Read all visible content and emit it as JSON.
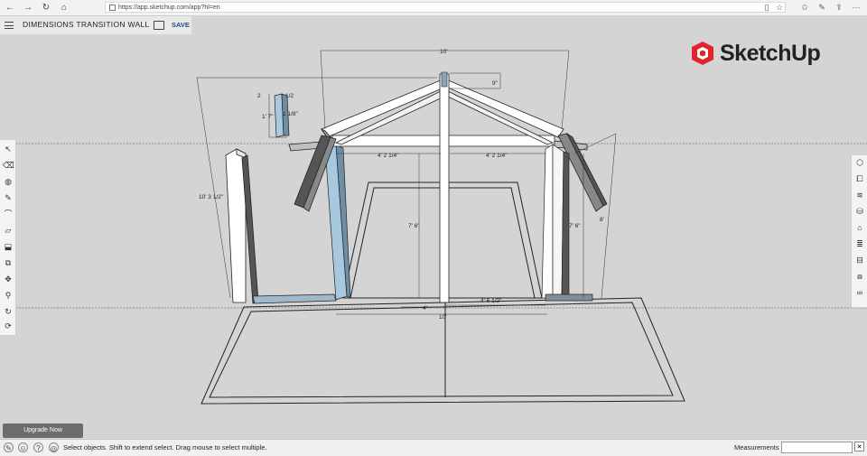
{
  "browser": {
    "url": "https://app.sketchup.com/app?hl=en"
  },
  "app": {
    "model_title": "DIMENSIONS TRANSITION WALL",
    "save_label": "SAVE",
    "logo_text": "SketchUp",
    "upgrade_label": "Upgrade Now"
  },
  "dimensions": {
    "overall_width_top": "10'",
    "rafter_rise": "9\"",
    "post_height": "10' 3 1/2\"",
    "detail_left": "2",
    "detail_right": "1/2",
    "detail_a": "1' 7\"",
    "detail_b": "1 1/8\"",
    "bay_left": "4' 2 1/4\"",
    "bay_right": "4' 2 1/4\"",
    "center_height": "7' 6\"",
    "right_height": "7' 6\"",
    "right_total": "8'",
    "bottom_small": "4'",
    "bottom_span": "4' 6 1/2\"",
    "bottom_total": "10'"
  },
  "status": {
    "hint": "Select objects. Shift to extend select. Drag mouse to select multiple.",
    "measurements_label": "Measurements"
  },
  "icons": {
    "left_tools": [
      "select-icon",
      "eraser-icon",
      "paint-icon",
      "pencil-icon",
      "arc-icon",
      "rectangle-icon",
      "push-pull-icon",
      "offset-icon",
      "move-icon",
      "rotate-icon",
      "tape-icon",
      "orbit-icon"
    ],
    "right_tools": [
      "entity-info-icon",
      "components-icon",
      "materials-icon",
      "styles-icon",
      "scenes-icon",
      "layers-icon",
      "outliner-icon",
      "views-icon",
      "display-icon"
    ]
  },
  "colors": {
    "brand_red": "#e0242b",
    "save_blue": "#1d4e8f",
    "canvas": "#d4d4d4",
    "selected_blue": "#a8c8e0"
  }
}
